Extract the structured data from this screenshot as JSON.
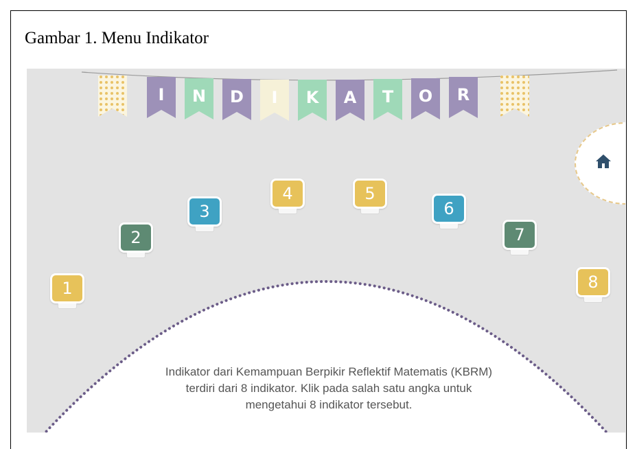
{
  "caption": "Gambar 1. Menu Indikator",
  "banner": {
    "letters": [
      "I",
      "N",
      "D",
      "I",
      "K",
      "A",
      "T",
      "O",
      "R"
    ],
    "colors": {
      "purple": "#9d91b8",
      "green": "#9fd9b8",
      "cream": "#f6f1d8",
      "dots": "#e9c267"
    }
  },
  "home_button": {
    "icon": "home-icon",
    "color": "#2f4f6b"
  },
  "indicators": [
    {
      "label": "1",
      "color": "#e7c25a"
    },
    {
      "label": "2",
      "color": "#5e8a73"
    },
    {
      "label": "3",
      "color": "#3fa2c3"
    },
    {
      "label": "4",
      "color": "#e7c25a"
    },
    {
      "label": "5",
      "color": "#e7c25a"
    },
    {
      "label": "6",
      "color": "#3fa2c3"
    },
    {
      "label": "7",
      "color": "#5e8a73"
    },
    {
      "label": "8",
      "color": "#e7c25a"
    }
  ],
  "description": "Indikator dari Kemampuan Berpikir Reflektif Matematis (KBRM)\nterdiri dari 8 indikator. Klik pada salah satu angka untuk\nmengetahui 8 indikator tersebut."
}
